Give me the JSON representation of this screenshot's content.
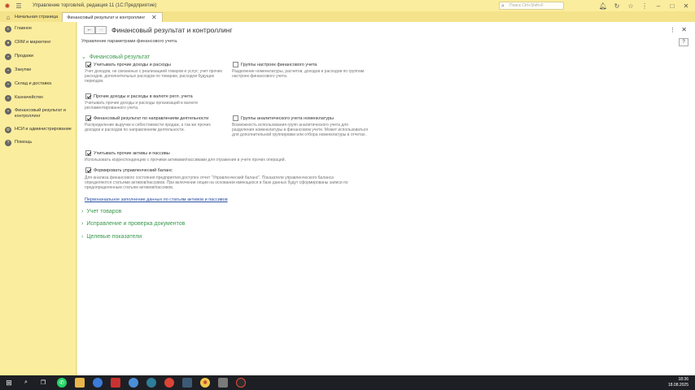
{
  "window": {
    "title": "Управление торговлей, редакция 11  (1С:Предприятие)",
    "search_placeholder": "Поиск Ctrl+Shift+F"
  },
  "tabs": {
    "home": "Начальная страница",
    "active": "Финансовый результат и контроллинг"
  },
  "sidebar": {
    "items": [
      {
        "label": "Главное",
        "icon": "list-icon"
      },
      {
        "label": "CRM и маркетинг",
        "icon": "crm-icon"
      },
      {
        "label": "Продажи",
        "icon": "sales-icon"
      },
      {
        "label": "Закупки",
        "icon": "purchases-icon"
      },
      {
        "label": "Склад и доставка",
        "icon": "warehouse-icon"
      },
      {
        "label": "Казначейство",
        "icon": "treasury-icon"
      },
      {
        "label": "Финансовый результат и контроллинг",
        "icon": "finance-icon"
      },
      {
        "label": "НСИ и администрирование",
        "icon": "settings-icon"
      },
      {
        "label": "Помощь",
        "icon": "help-icon"
      }
    ]
  },
  "page": {
    "title": "Финансовый результат и контроллинг",
    "subtitle": "Управление параметрами финансового учета.",
    "help": "?",
    "groups": {
      "fin_result": "Финансовый результат",
      "goods": "Учет товаров",
      "docs": "Исправление и проверка документов",
      "targets": "Целевые показатели"
    },
    "options": {
      "other_income": {
        "label": "Учитывать прочие доходы и расходы",
        "checked": true,
        "desc": "Учет доходов, не связанных с реализацией товаров и услуг; учет прочих расходов, дополнительных расходов по товарам, расходов будущих периодов."
      },
      "settings_groups": {
        "label": "Группы настроек финансового учета",
        "checked": false,
        "desc": "Разделение номенклатуры, расчетов, доходов и расходов по группам настроек финансового учета."
      },
      "currency_income": {
        "label": "Прочие доходы и расходы в валюте регл. учета",
        "checked": true,
        "desc": "Учитывать прочие доходы и расходы организаций в валюте регламентированного учета."
      },
      "by_direction": {
        "label": "Финансовый результат по направлениям деятельности",
        "checked": true,
        "desc": "Распределение выручки и себестоимости продаж, а так же прочих доходов и расходов по направлениям деятельности."
      },
      "analytic_groups": {
        "label": "Группы аналитического учета номенклатуры",
        "checked": false,
        "desc": "Возможность использования групп аналитического учета для разделения номенклатуры в финансовом учете. Может использоваться для дополнительной группировки или отбора номенклатуры в отчетах."
      },
      "other_assets": {
        "label": "Учитывать прочие активы и пассивы",
        "checked": true,
        "desc": "Использовать корреспонденцию с прочими активами/пассивами для отражения в учете прочих операций."
      },
      "mgmt_balance": {
        "label": "Формировать управленческий баланс",
        "checked": true,
        "desc": "Для анализа финансового состояния предприятия доступен отчет \"Управленческий баланс\". Показатели управленческого баланса определяются статьями активов/пассивов. При включении опции на основании имеющихся в базе данных будут сформированы записи по предопределенным статьям активов/пассивов."
      }
    },
    "link_fill": "Первоначальное заполнение данных по статьям активов и пассивов"
  },
  "taskbar": {
    "time": "18:36",
    "date": "18.08.2025"
  }
}
